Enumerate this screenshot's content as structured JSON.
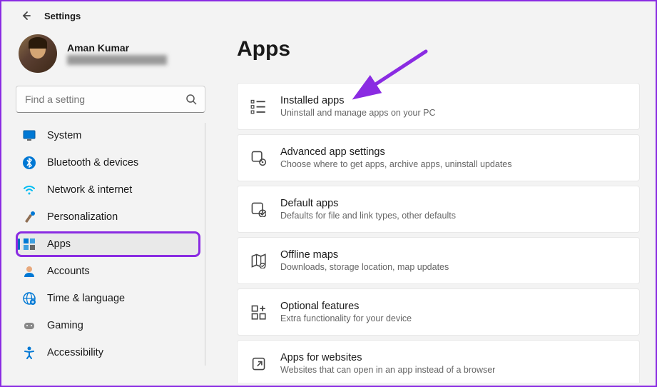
{
  "header": {
    "title": "Settings"
  },
  "profile": {
    "name": "Aman Kumar"
  },
  "search": {
    "placeholder": "Find a setting"
  },
  "sidebar": {
    "items": [
      {
        "label": "System",
        "icon": "system",
        "selected": false
      },
      {
        "label": "Bluetooth & devices",
        "icon": "bluetooth",
        "selected": false
      },
      {
        "label": "Network & internet",
        "icon": "wifi",
        "selected": false
      },
      {
        "label": "Personalization",
        "icon": "brush",
        "selected": false
      },
      {
        "label": "Apps",
        "icon": "apps",
        "selected": true
      },
      {
        "label": "Accounts",
        "icon": "person",
        "selected": false
      },
      {
        "label": "Time & language",
        "icon": "globe",
        "selected": false
      },
      {
        "label": "Gaming",
        "icon": "gamepad",
        "selected": false
      },
      {
        "label": "Accessibility",
        "icon": "accessibility",
        "selected": false
      }
    ]
  },
  "main": {
    "title": "Apps",
    "cards": [
      {
        "title": "Installed apps",
        "desc": "Uninstall and manage apps on your PC",
        "icon": "list"
      },
      {
        "title": "Advanced app settings",
        "desc": "Choose where to get apps, archive apps, uninstall updates",
        "icon": "gear-app"
      },
      {
        "title": "Default apps",
        "desc": "Defaults for file and link types, other defaults",
        "icon": "default-app"
      },
      {
        "title": "Offline maps",
        "desc": "Downloads, storage location, map updates",
        "icon": "map"
      },
      {
        "title": "Optional features",
        "desc": "Extra functionality for your device",
        "icon": "plus-grid"
      },
      {
        "title": "Apps for websites",
        "desc": "Websites that can open in an app instead of a browser",
        "icon": "share"
      }
    ]
  },
  "annotation": {
    "arrow_color": "#8a2be2",
    "highlight_color": "#8a2be2"
  }
}
